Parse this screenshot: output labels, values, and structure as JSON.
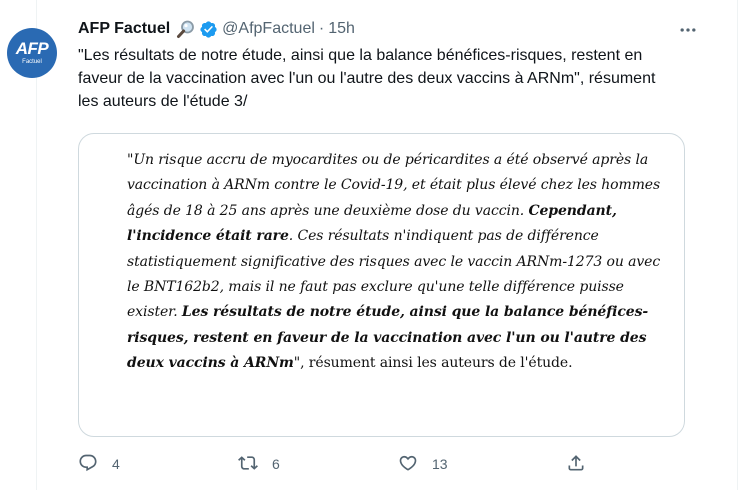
{
  "tweet": {
    "author_name": "AFP Factuel",
    "handle": "@AfpFactuel",
    "separator": "·",
    "time": "15h",
    "avatar": {
      "logo_text": "AFP",
      "sub_text": "Factuel",
      "bg_color": "#2a6ab3"
    },
    "text": "\"Les résultats de notre étude, ainsi que la balance bénéfices-risques, restent en faveur de la vaccination avec l'un ou l'autre des deux vaccins à ARNm\", résument les auteurs de l'étude 3/",
    "quote": {
      "part1": "\"Un risque accru de myocardites ou de péricardites a été observé après la vaccination à ARNm contre le Covid-19, et était plus élevé chez les hommes âgés de 18 à 25 ans après une deuxième dose du vaccin. ",
      "bold1": "Cependant, l'incidence était rare",
      "part2": ". Ces résultats n'indiquent pas de différence statistiquement significative des risques avec le vaccin ARNm-1273 ou avec le BNT162b2, mais il ne faut pas exclure qu'une telle différence puisse exister. ",
      "bold2": "Les résultats de notre étude, ainsi que la balance bénéfices-risques, restent en faveur de la vaccination avec l'un ou l'autre des deux vaccins à ARNm",
      "part3": "\", résument ainsi les auteurs de l'étude."
    },
    "actions": {
      "reply_count": "4",
      "retweet_count": "6",
      "like_count": "13"
    },
    "icons": [
      "magnifier-icon",
      "verified-badge-icon",
      "more-icon",
      "reply-icon",
      "retweet-icon",
      "like-icon",
      "share-icon"
    ],
    "colors": {
      "secondary_text": "#536471",
      "verified": "#1d9bf0",
      "border": "#cfd9de"
    }
  }
}
